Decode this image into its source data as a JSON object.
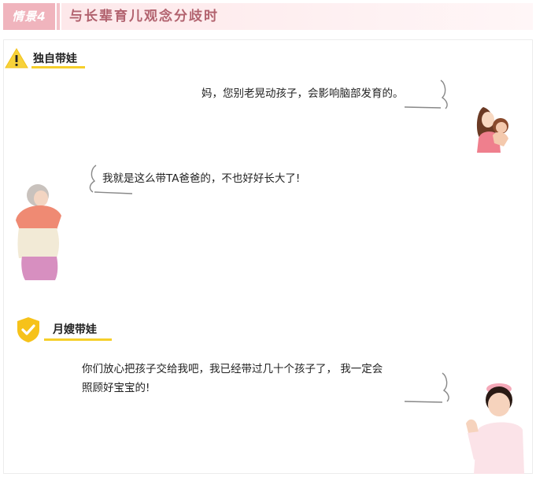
{
  "header": {
    "tag": "情景4",
    "title": "与长辈育儿观念分歧时"
  },
  "sections": {
    "solo": {
      "label": "独自带娃",
      "icon": "warning-icon",
      "mother_line": "妈，您别老晃动孩子，会影响脑部发育的。",
      "grandma_line": "我就是这么带TA爸爸的，不也好好长大了!"
    },
    "nanny": {
      "label": "月嫂带娃",
      "icon": "shield-check-icon",
      "nanny_line_1": "你们放心把孩子交给我吧，我已经带过几十个孩子了， 我一定会",
      "nanny_line_2": "照顾好宝宝的!"
    }
  },
  "colors": {
    "accent_pink": "#f0b4bd",
    "title_text": "#b2636f",
    "underline_yellow": "#f6cf2a"
  }
}
